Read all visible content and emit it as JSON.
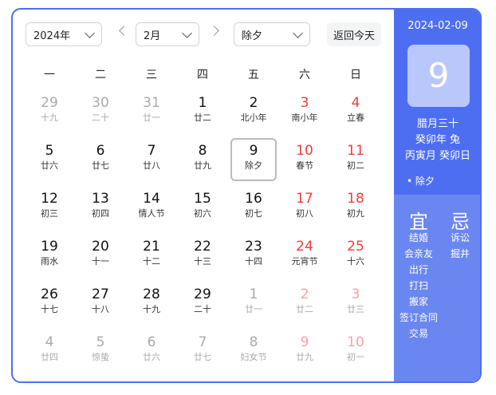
{
  "selectors": {
    "year": "2024年",
    "month": "2月",
    "holiday": "除夕"
  },
  "today_button": "返回今天",
  "weekdays": [
    "一",
    "二",
    "三",
    "四",
    "五",
    "六",
    "日"
  ],
  "days": [
    {
      "n": "29",
      "l": "十九",
      "other": true,
      "red": false
    },
    {
      "n": "30",
      "l": "二十",
      "other": true,
      "red": false
    },
    {
      "n": "31",
      "l": "廿一",
      "other": true,
      "red": false
    },
    {
      "n": "1",
      "l": "廿二",
      "other": false,
      "red": false
    },
    {
      "n": "2",
      "l": "北小年",
      "other": false,
      "red": false
    },
    {
      "n": "3",
      "l": "南小年",
      "other": false,
      "red": true
    },
    {
      "n": "4",
      "l": "立春",
      "other": false,
      "red": true
    },
    {
      "n": "5",
      "l": "廿六",
      "other": false,
      "red": false
    },
    {
      "n": "6",
      "l": "廿七",
      "other": false,
      "red": false
    },
    {
      "n": "7",
      "l": "廿八",
      "other": false,
      "red": false
    },
    {
      "n": "8",
      "l": "廿九",
      "other": false,
      "red": false
    },
    {
      "n": "9",
      "l": "除夕",
      "other": false,
      "red": false,
      "selected": true
    },
    {
      "n": "10",
      "l": "春节",
      "other": false,
      "red": true
    },
    {
      "n": "11",
      "l": "初二",
      "other": false,
      "red": true
    },
    {
      "n": "12",
      "l": "初三",
      "other": false,
      "red": false
    },
    {
      "n": "13",
      "l": "初四",
      "other": false,
      "red": false
    },
    {
      "n": "14",
      "l": "情人节",
      "other": false,
      "red": false
    },
    {
      "n": "15",
      "l": "初六",
      "other": false,
      "red": false
    },
    {
      "n": "16",
      "l": "初七",
      "other": false,
      "red": false
    },
    {
      "n": "17",
      "l": "初八",
      "other": false,
      "red": true
    },
    {
      "n": "18",
      "l": "初九",
      "other": false,
      "red": true
    },
    {
      "n": "19",
      "l": "雨水",
      "other": false,
      "red": false
    },
    {
      "n": "20",
      "l": "十一",
      "other": false,
      "red": false
    },
    {
      "n": "21",
      "l": "十二",
      "other": false,
      "red": false
    },
    {
      "n": "22",
      "l": "十三",
      "other": false,
      "red": false
    },
    {
      "n": "23",
      "l": "十四",
      "other": false,
      "red": false
    },
    {
      "n": "24",
      "l": "元宵节",
      "other": false,
      "red": true
    },
    {
      "n": "25",
      "l": "十六",
      "other": false,
      "red": true
    },
    {
      "n": "26",
      "l": "十七",
      "other": false,
      "red": false
    },
    {
      "n": "27",
      "l": "十八",
      "other": false,
      "red": false
    },
    {
      "n": "28",
      "l": "十九",
      "other": false,
      "red": false
    },
    {
      "n": "29",
      "l": "二十",
      "other": false,
      "red": false
    },
    {
      "n": "1",
      "l": "廿一",
      "other": true,
      "red": false
    },
    {
      "n": "2",
      "l": "廿二",
      "other": true,
      "red": true
    },
    {
      "n": "3",
      "l": "廿三",
      "other": true,
      "red": true
    },
    {
      "n": "4",
      "l": "廿四",
      "other": true,
      "red": false
    },
    {
      "n": "5",
      "l": "惊蛰",
      "other": true,
      "red": false
    },
    {
      "n": "6",
      "l": "廿六",
      "other": true,
      "red": false
    },
    {
      "n": "7",
      "l": "廿七",
      "other": true,
      "red": false
    },
    {
      "n": "8",
      "l": "妇女节",
      "other": true,
      "red": false
    },
    {
      "n": "9",
      "l": "廿九",
      "other": true,
      "red": true
    },
    {
      "n": "10",
      "l": "初一",
      "other": true,
      "red": true
    }
  ],
  "panel": {
    "date": "2024-02-09",
    "day": "9",
    "lunar": "腊月三十",
    "ganzhi_year": "癸卯年 兔",
    "ganzhi_month_day": "丙寅月 癸卯日",
    "festival": "• 除夕",
    "yi_title": "宜",
    "ji_title": "忌",
    "yi": [
      "结婚",
      "会亲友",
      "出行",
      "打扫",
      "搬家",
      "签订合同",
      "交易"
    ],
    "ji": [
      "诉讼",
      "掘井"
    ]
  }
}
